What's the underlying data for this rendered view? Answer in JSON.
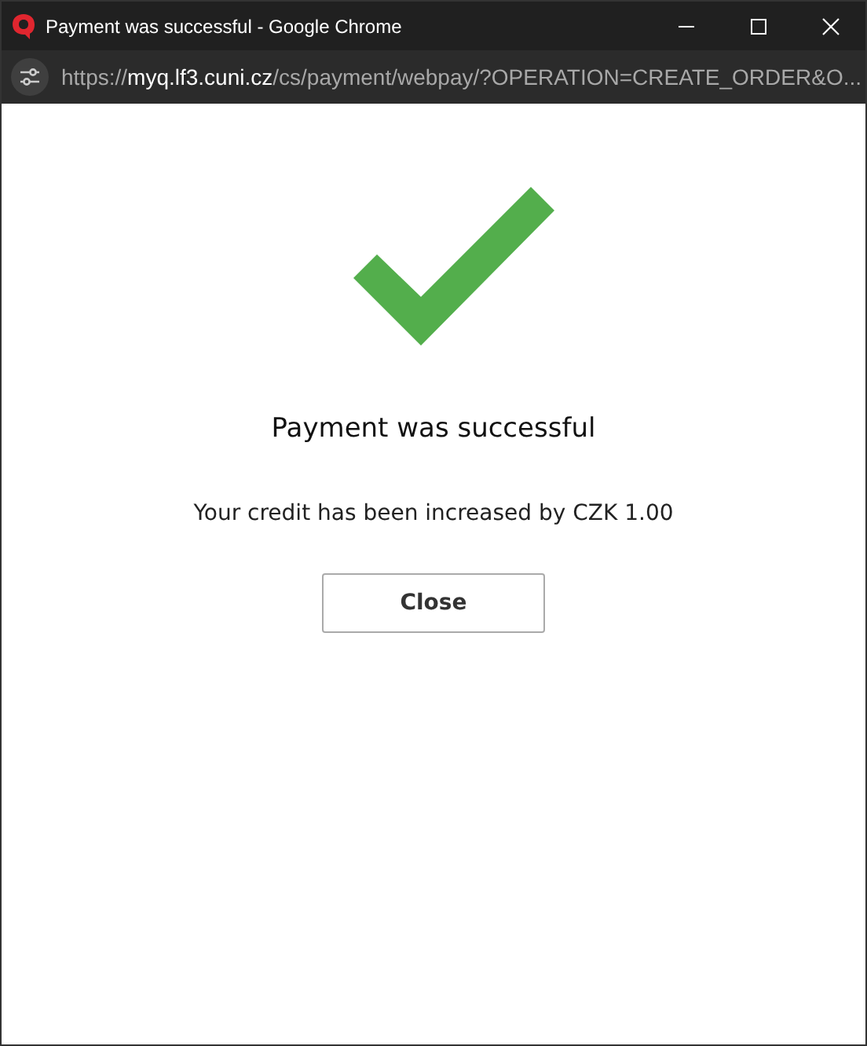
{
  "window": {
    "title": "Payment was successful - Google Chrome"
  },
  "address_bar": {
    "scheme": "https://",
    "host": "myq.lf3.cuni.cz",
    "path": "/cs/payment/webpay/?OPERATION=CREATE_ORDER&O..."
  },
  "content": {
    "heading": "Payment was successful",
    "message": "Your credit has been increased by CZK 1.00",
    "button": "Close"
  }
}
